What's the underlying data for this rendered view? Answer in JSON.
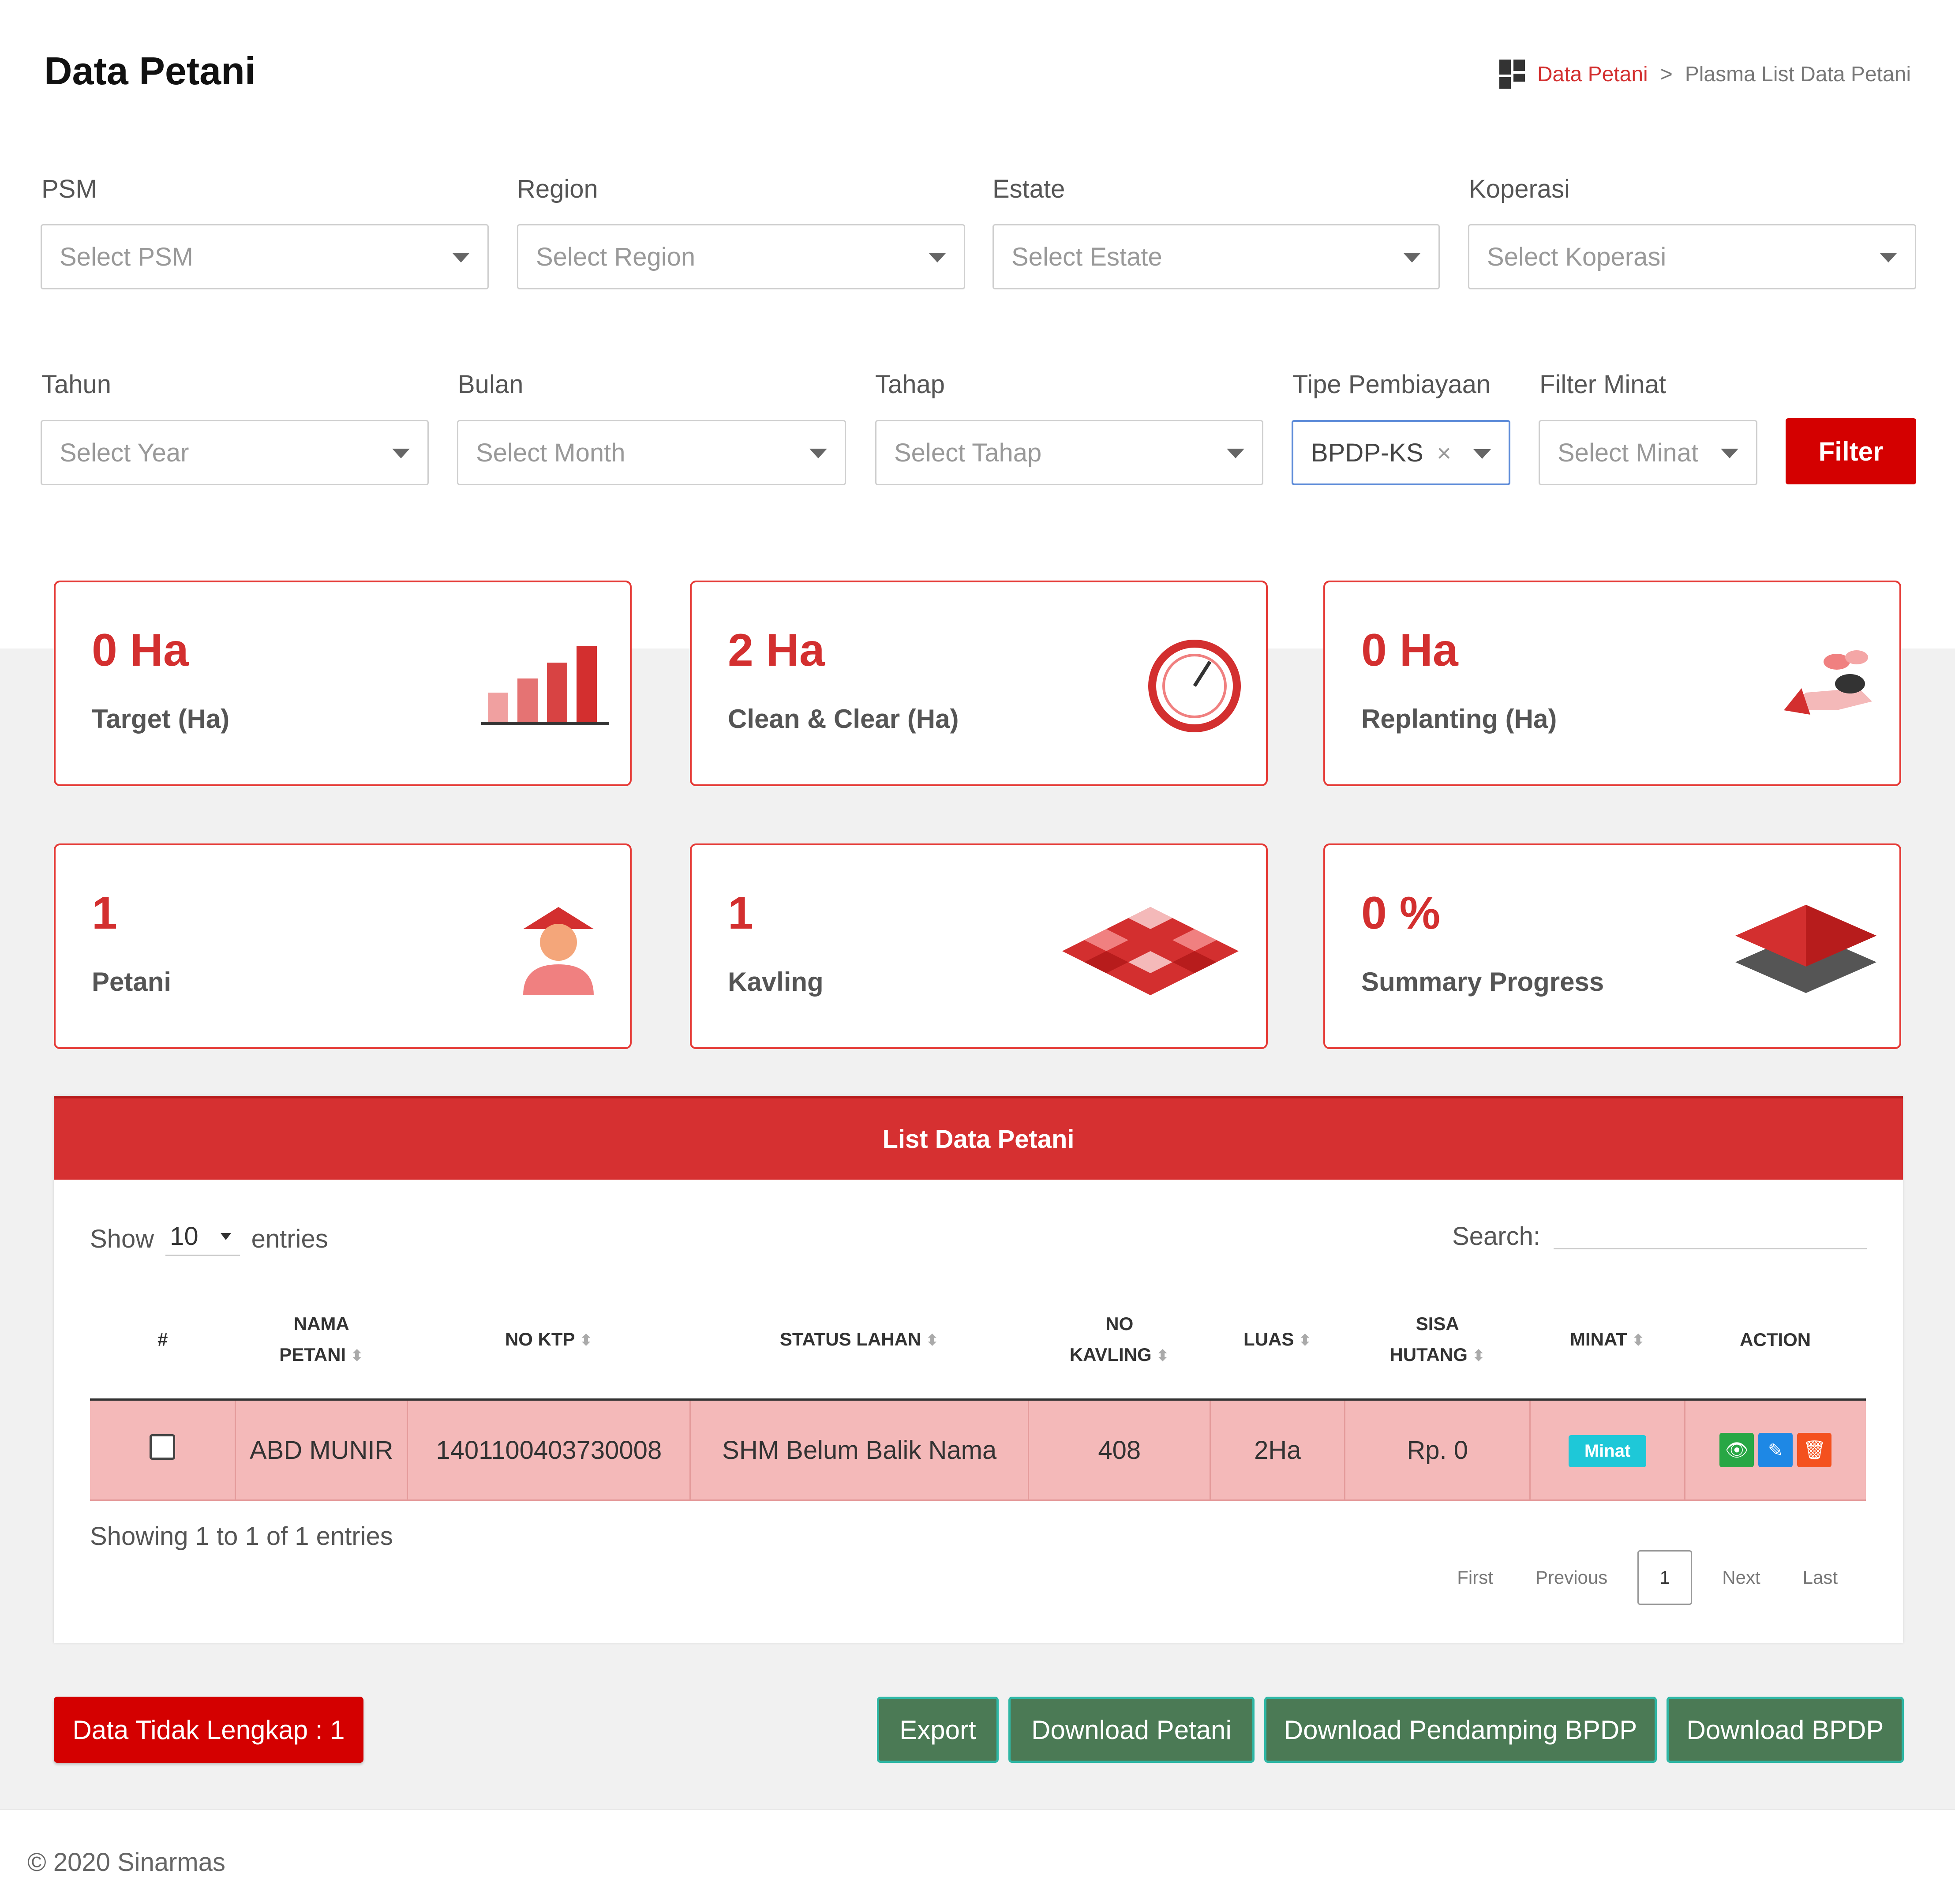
{
  "page": {
    "title": "Data Petani"
  },
  "breadcrumb": {
    "home": "Data Petani",
    "separator": ">",
    "current": "Plasma List Data Petani"
  },
  "filters": {
    "psm": {
      "label": "PSM",
      "placeholder": "Select PSM"
    },
    "region": {
      "label": "Region",
      "placeholder": "Select Region"
    },
    "estate": {
      "label": "Estate",
      "placeholder": "Select Estate"
    },
    "koperasi": {
      "label": "Koperasi",
      "placeholder": "Select Koperasi"
    },
    "tahun": {
      "label": "Tahun",
      "placeholder": "Select Year"
    },
    "bulan": {
      "label": "Bulan",
      "placeholder": "Select Month"
    },
    "tahap": {
      "label": "Tahap",
      "placeholder": "Select Tahap"
    },
    "tipe": {
      "label": "Tipe Pembiayaan",
      "value": "BPDP-KS",
      "clear": "×"
    },
    "minat": {
      "label": "Filter Minat",
      "placeholder": "Select Minat"
    },
    "button": "Filter"
  },
  "cards": {
    "target": {
      "value": "0 Ha",
      "label": "Target (Ha)",
      "icon": "bar-chart-icon"
    },
    "clean": {
      "value": "2 Ha",
      "label": "Clean & Clear (Ha)",
      "icon": "gauge-icon"
    },
    "replanting": {
      "value": "0 Ha",
      "label": "Replanting (Ha)",
      "icon": "plant-hand-icon"
    },
    "petani": {
      "value": "1",
      "label": "Petani",
      "icon": "farmer-icon"
    },
    "kavling": {
      "value": "1",
      "label": "Kavling",
      "icon": "plots-icon"
    },
    "progress": {
      "value": "0 %",
      "label": "Summary Progress",
      "icon": "layers-icon"
    }
  },
  "table": {
    "title": "List Data Petani",
    "show_label": "Show",
    "show_value": "10",
    "entries_label": "entries",
    "search_label": "Search:",
    "headers": {
      "num": "#",
      "nama_1": "NAMA",
      "nama_2": "PETANI",
      "ktp": "NO KTP",
      "status": "STATUS LAHAN",
      "kavling_1": "NO",
      "kavling_2": "KAVLING",
      "luas": "LUAS",
      "hutang_1": "SISA",
      "hutang_2": "HUTANG",
      "minat": "MINAT",
      "action": "ACTION"
    },
    "rows": [
      {
        "nama": "ABD MUNIR",
        "ktp": "1401100403730008",
        "status": "SHM Belum Balik Nama",
        "kavling": "408",
        "luas": "2Ha",
        "hutang": "Rp. 0",
        "minat": "Minat"
      }
    ],
    "info": "Showing 1 to 1 of 1 entries",
    "pager": {
      "first": "First",
      "previous": "Previous",
      "current": "1",
      "next": "Next",
      "last": "Last"
    }
  },
  "actions": {
    "incomplete": "Data Tidak Lengkap : 1",
    "export": "Export",
    "download_petani": "Download Petani",
    "download_pendamping": "Download Pendamping BPDP",
    "download_bpdp": "Download BPDP"
  },
  "footer": {
    "text": "© 2020 Sinarmas"
  },
  "colors": {
    "primary": "#d32f2f",
    "filter_button": "#d40000",
    "row_highlight": "#f4b9b9",
    "green_button": "#4b7a55",
    "badge": "#1ec8d8"
  }
}
